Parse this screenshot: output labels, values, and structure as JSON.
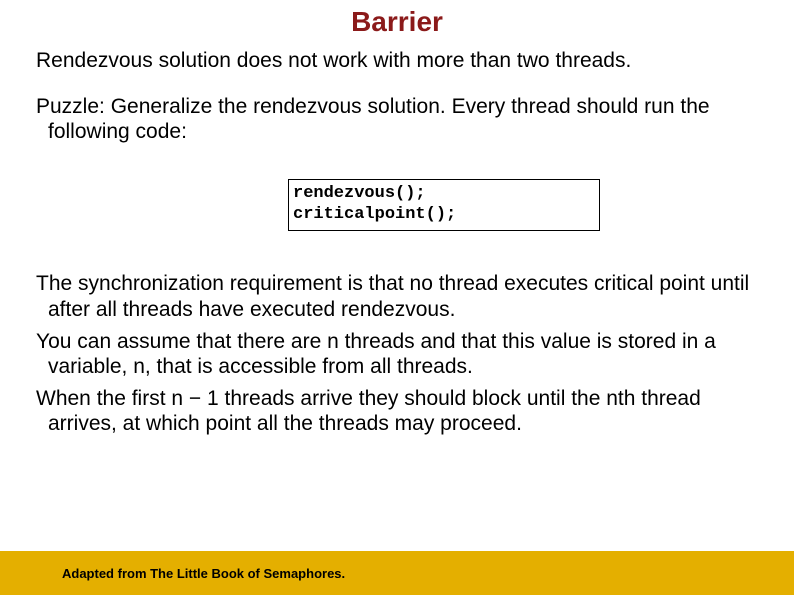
{
  "title": "Barrier",
  "para1": "Rendezvous solution does not work with more than two threads.",
  "para2": "Puzzle: Generalize the rendezvous solution. Every thread should run the following code:",
  "code": {
    "line1": "rendezvous();",
    "line2": "criticalpoint();"
  },
  "para3": "The synchronization requirement is that no thread executes critical point until after all threads have executed rendezvous.",
  "para4": "You can assume that there are n threads and that this value is stored in a variable, n, that is accessible from all threads.",
  "para5": "When the first n − 1 threads arrive they should block until the nth thread arrives, at which point all the threads may proceed.",
  "footer": "Adapted from The Little Book of Semaphores."
}
